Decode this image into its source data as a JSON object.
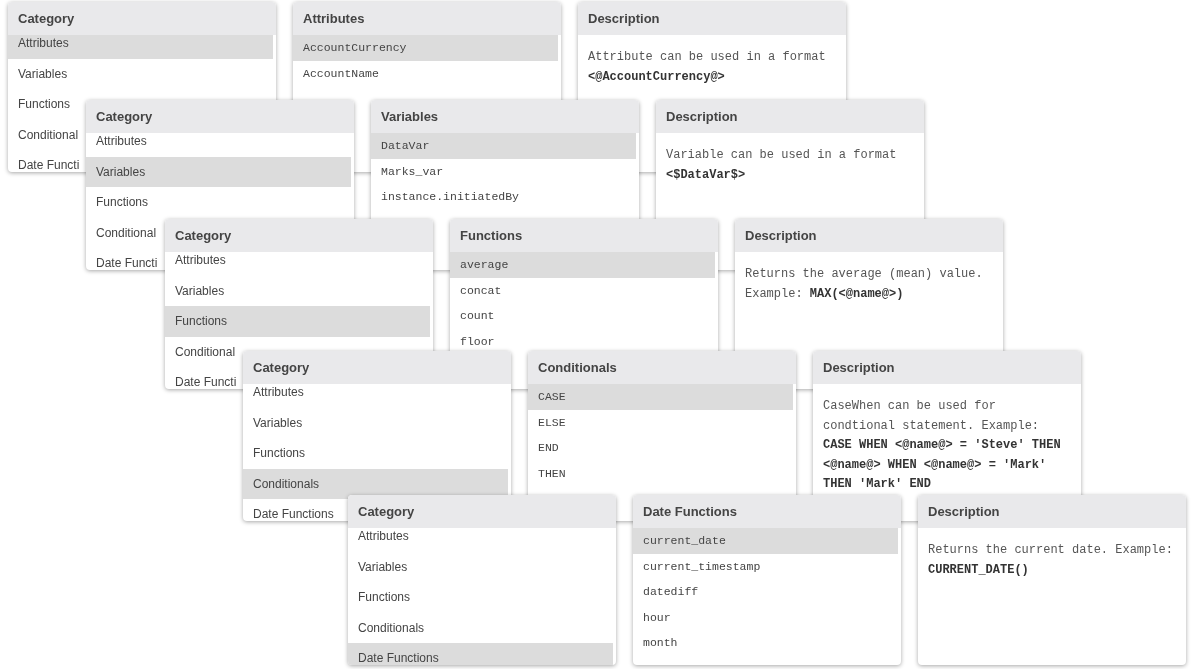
{
  "snapshots": [
    {
      "category_panel": {
        "title": "Category",
        "items": [
          {
            "label": "Attributes",
            "selected": true
          },
          {
            "label": "Variables",
            "selected": false
          },
          {
            "label": "Functions",
            "selected": false
          },
          {
            "label": "Conditional",
            "selected": false
          },
          {
            "label": "Date Functi",
            "selected": false
          }
        ]
      },
      "item_panel": {
        "title": "Attributes",
        "items": [
          {
            "label": "AccountCurrency",
            "selected": true
          },
          {
            "label": "AccountName",
            "selected": false
          }
        ]
      },
      "description_panel": {
        "title": "Description",
        "text": "Attribute can be used in a format **<@AccountCurrency@>**"
      }
    },
    {
      "category_panel": {
        "title": "Category",
        "items": [
          {
            "label": "Attributes",
            "selected": false
          },
          {
            "label": "Variables",
            "selected": true
          },
          {
            "label": "Functions",
            "selected": false
          },
          {
            "label": "Conditional",
            "selected": false
          },
          {
            "label": "Date Functi",
            "selected": false
          }
        ]
      },
      "item_panel": {
        "title": "Variables",
        "items": [
          {
            "label": "DataVar",
            "selected": true
          },
          {
            "label": "Marks_var",
            "selected": false
          },
          {
            "label": "instance.initiatedBy",
            "selected": false
          }
        ]
      },
      "description_panel": {
        "title": "Description",
        "text": "Variable can be used in a format **<$DataVar$>**"
      }
    },
    {
      "category_panel": {
        "title": "Category",
        "items": [
          {
            "label": "Attributes",
            "selected": false
          },
          {
            "label": "Variables",
            "selected": false
          },
          {
            "label": "Functions",
            "selected": true
          },
          {
            "label": "Conditional",
            "selected": false
          },
          {
            "label": "Date Functi",
            "selected": false
          }
        ]
      },
      "item_panel": {
        "title": "Functions",
        "items": [
          {
            "label": "average",
            "selected": true
          },
          {
            "label": "concat",
            "selected": false
          },
          {
            "label": "count",
            "selected": false
          },
          {
            "label": "floor",
            "selected": false
          }
        ]
      },
      "description_panel": {
        "title": "Description",
        "text": "Returns the average (mean) value. Example: **MAX(<@name@>)**"
      }
    },
    {
      "category_panel": {
        "title": "Category",
        "items": [
          {
            "label": "Attributes",
            "selected": false
          },
          {
            "label": "Variables",
            "selected": false
          },
          {
            "label": "Functions",
            "selected": false
          },
          {
            "label": "Conditionals",
            "selected": true
          },
          {
            "label": "Date Functions",
            "selected": false
          }
        ]
      },
      "item_panel": {
        "title": "Conditionals",
        "items": [
          {
            "label": "CASE",
            "selected": true
          },
          {
            "label": "ELSE",
            "selected": false
          },
          {
            "label": "END",
            "selected": false
          },
          {
            "label": "THEN",
            "selected": false
          }
        ]
      },
      "description_panel": {
        "title": "Description",
        "text": "CaseWhen can be used for condtional statement. Example: **CASE WHEN <@name@> = 'Steve' THEN <@name@> WHEN <@name@> = 'Mark' THEN 'Mark' END**"
      }
    },
    {
      "category_panel": {
        "title": "Category",
        "items": [
          {
            "label": "Attributes",
            "selected": false
          },
          {
            "label": "Variables",
            "selected": false
          },
          {
            "label": "Functions",
            "selected": false
          },
          {
            "label": "Conditionals",
            "selected": false
          },
          {
            "label": "Date Functions",
            "selected": true
          }
        ]
      },
      "item_panel": {
        "title": "Date Functions",
        "items": [
          {
            "label": "current_date",
            "selected": true
          },
          {
            "label": "current_timestamp",
            "selected": false
          },
          {
            "label": "datediff",
            "selected": false
          },
          {
            "label": "hour",
            "selected": false
          },
          {
            "label": "month",
            "selected": false
          }
        ]
      },
      "description_panel": {
        "title": "Description",
        "text": "Returns the current date. Example: **CURRENT_DATE()**"
      }
    }
  ]
}
